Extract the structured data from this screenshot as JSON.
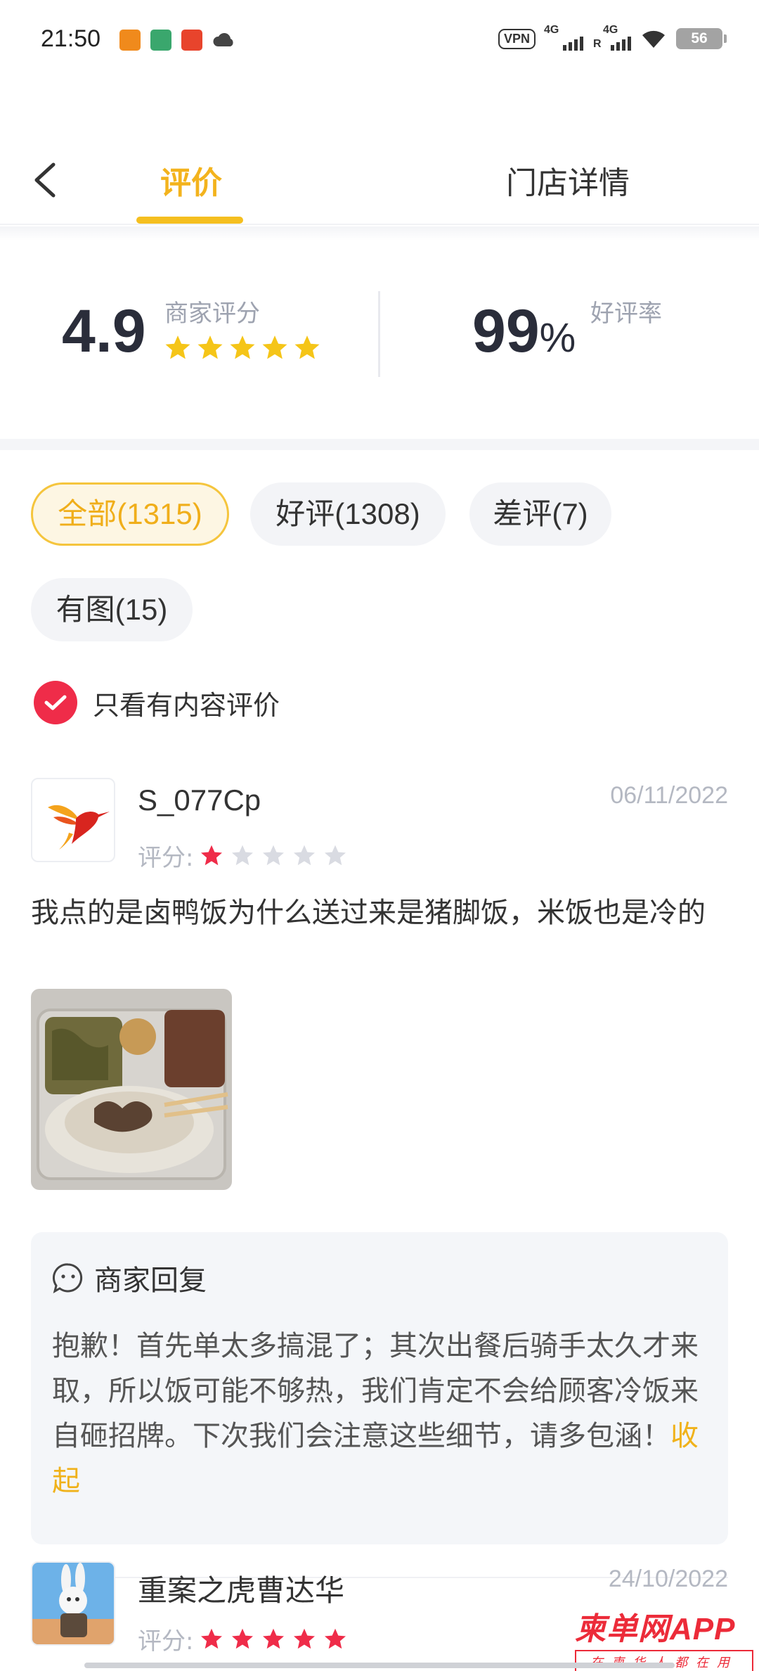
{
  "status_bar": {
    "time": "21:50",
    "vpn": "VPN",
    "network_1": "4G",
    "network_2": "4G",
    "roaming": "R",
    "battery": "56"
  },
  "header": {
    "tab_reviews": "评价",
    "tab_store": "门店详情"
  },
  "score": {
    "merchant_score": "4.9",
    "merchant_score_label": "商家评分",
    "merchant_stars": 5,
    "good_rate": "99",
    "good_rate_unit": "%",
    "good_rate_label": "好评率"
  },
  "filters": {
    "all": "全部(1315)",
    "good": "好评(1308)",
    "bad": "差评(7)",
    "with_photo": "有图(15)",
    "content_only": "只看有内容评价"
  },
  "reviews": [
    {
      "user": "S_077Cp",
      "date": "06/11/2022",
      "rating_label": "评分:",
      "rating": 1,
      "text": "我点的是卤鸭饭为什么送过来是猪脚饭，米饭也是冷的",
      "reply_title": "商家回复",
      "reply_text": "抱歉！首先单太多搞混了；其次出餐后骑手太久才来取，所以饭可能不够热，我们肯定不会给顾客冷饭来自砸招牌。下次我们会注意这些细节，请多包涵！",
      "reply_collapse": "收起"
    },
    {
      "user": "重案之虎曹达华",
      "date": "24/10/2022",
      "rating_label": "评分:",
      "rating": 5
    }
  ],
  "watermark": {
    "brand": "柬单网APP",
    "slogan": "在柬华人都在用"
  },
  "colors": {
    "accent": "#f5bf1f",
    "star_filled": "#f5c518",
    "star_red": "#ef2c49",
    "star_empty": "#d9dbe2"
  }
}
